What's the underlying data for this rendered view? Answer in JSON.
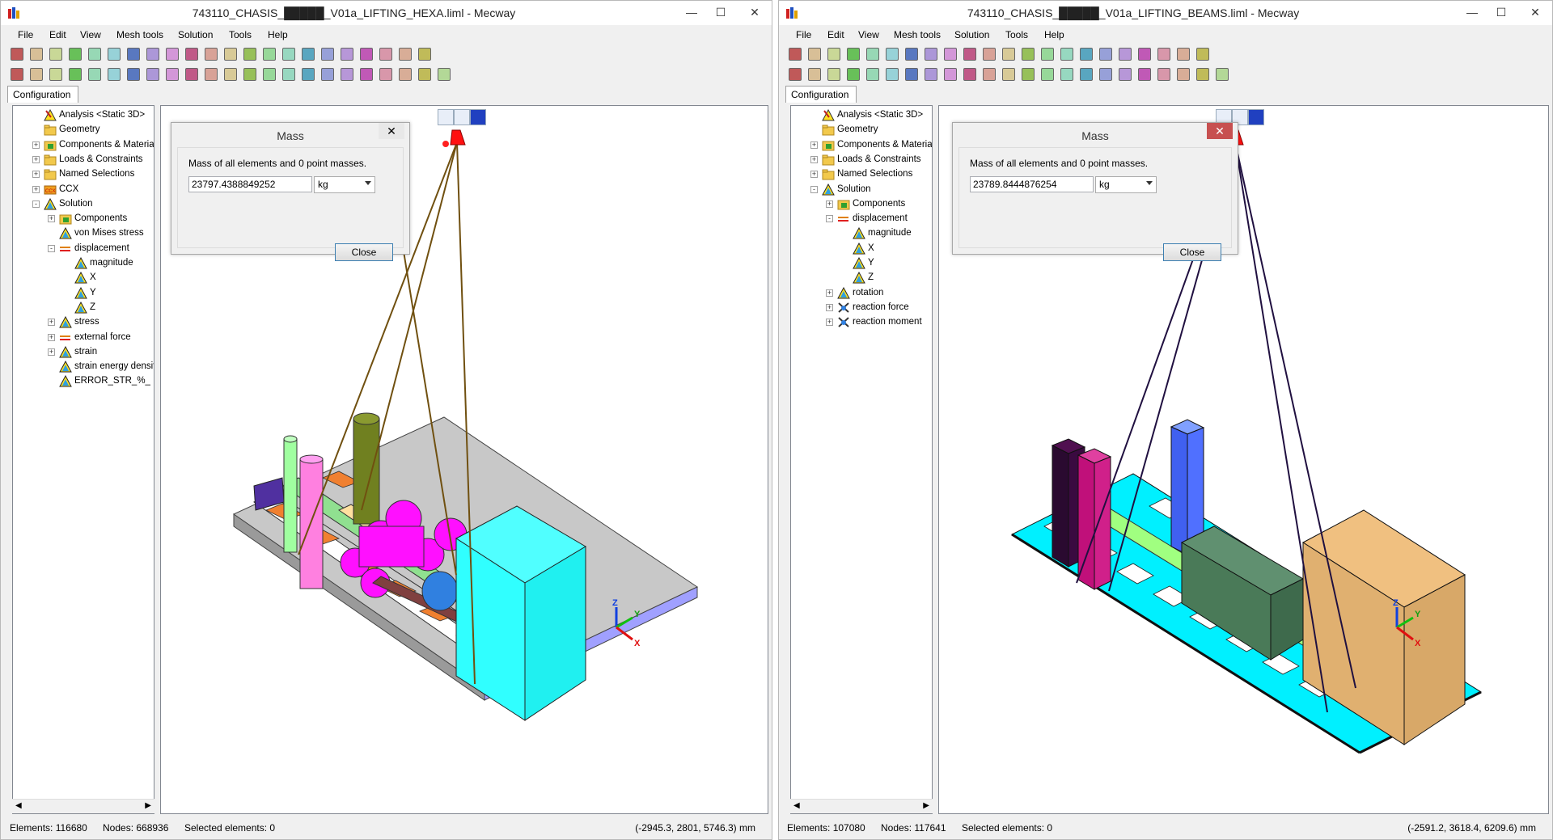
{
  "colors": {
    "accent": "#3c7fb1",
    "close_red": "#c75050"
  },
  "menu": [
    "File",
    "Edit",
    "View",
    "Mesh tools",
    "Solution",
    "Tools",
    "Help"
  ],
  "left": {
    "title": "743110_CHASIS_█████_V01a_LIFTING_HEXA.liml - Mecway",
    "tab": "Configuration",
    "tree": [
      {
        "label": "Analysis <Static 3D>",
        "icon": "analysis-icon",
        "indent": 0,
        "exp": ""
      },
      {
        "label": "Geometry",
        "icon": "folder-icon",
        "indent": 0,
        "exp": ""
      },
      {
        "label": "Components & Materials",
        "icon": "components-icon",
        "indent": 0,
        "exp": "+"
      },
      {
        "label": "Loads & Constraints",
        "icon": "folder-icon",
        "indent": 0,
        "exp": "+"
      },
      {
        "label": "Named Selections",
        "icon": "folder-icon",
        "indent": 0,
        "exp": "+"
      },
      {
        "label": "CCX",
        "icon": "ccx-icon",
        "indent": 0,
        "exp": "+"
      },
      {
        "label": "Solution",
        "icon": "solution-icon",
        "indent": 0,
        "exp": "-"
      },
      {
        "label": "Components",
        "icon": "components-icon",
        "indent": 1,
        "exp": "+"
      },
      {
        "label": "von Mises stress",
        "icon": "solution-icon",
        "indent": 1,
        "exp": ""
      },
      {
        "label": "displacement",
        "icon": "displacement-icon",
        "indent": 1,
        "exp": "-"
      },
      {
        "label": "magnitude",
        "icon": "solution-icon",
        "indent": 2,
        "exp": ""
      },
      {
        "label": "X",
        "icon": "solution-icon",
        "indent": 2,
        "exp": ""
      },
      {
        "label": "Y",
        "icon": "solution-icon",
        "indent": 2,
        "exp": ""
      },
      {
        "label": "Z",
        "icon": "solution-icon",
        "indent": 2,
        "exp": ""
      },
      {
        "label": "stress",
        "icon": "solution-icon",
        "indent": 1,
        "exp": "+"
      },
      {
        "label": "external force",
        "icon": "displacement-icon",
        "indent": 1,
        "exp": "+"
      },
      {
        "label": "strain",
        "icon": "solution-icon",
        "indent": 1,
        "exp": "+"
      },
      {
        "label": "strain energy density",
        "icon": "solution-icon",
        "indent": 1,
        "exp": ""
      },
      {
        "label": "ERROR_STR_%_",
        "icon": "solution-icon",
        "indent": 1,
        "exp": ""
      }
    ],
    "dialog": {
      "title": "Mass",
      "message": "Mass of all elements and 0 point masses.",
      "value": "23797.4388849252",
      "unit": "kg",
      "button": "Close"
    },
    "status": {
      "elements": "Elements: 116680",
      "nodes": "Nodes: 668936",
      "selected": "Selected elements: 0",
      "coords": "(-2945.3, 2801, 5746.3) mm"
    }
  },
  "right": {
    "title": "743110_CHASIS_█████_V01a_LIFTING_BEAMS.liml - Mecway",
    "tab": "Configuration",
    "tree": [
      {
        "label": "Analysis <Static 3D>",
        "icon": "analysis-icon",
        "indent": 0,
        "exp": ""
      },
      {
        "label": "Geometry",
        "icon": "folder-icon",
        "indent": 0,
        "exp": ""
      },
      {
        "label": "Components & Materials",
        "icon": "components-icon",
        "indent": 0,
        "exp": "+"
      },
      {
        "label": "Loads & Constraints",
        "icon": "folder-icon",
        "indent": 0,
        "exp": "+"
      },
      {
        "label": "Named Selections",
        "icon": "folder-icon",
        "indent": 0,
        "exp": "+"
      },
      {
        "label": "Solution",
        "icon": "solution-icon",
        "indent": 0,
        "exp": "-"
      },
      {
        "label": "Components",
        "icon": "components-icon",
        "indent": 1,
        "exp": "+"
      },
      {
        "label": "displacement",
        "icon": "displacement-icon",
        "indent": 1,
        "exp": "-"
      },
      {
        "label": "magnitude",
        "icon": "solution-icon",
        "indent": 2,
        "exp": ""
      },
      {
        "label": "X",
        "icon": "solution-icon",
        "indent": 2,
        "exp": ""
      },
      {
        "label": "Y",
        "icon": "solution-icon",
        "indent": 2,
        "exp": ""
      },
      {
        "label": "Z",
        "icon": "solution-icon",
        "indent": 2,
        "exp": ""
      },
      {
        "label": "rotation",
        "icon": "solution-icon",
        "indent": 1,
        "exp": "+"
      },
      {
        "label": "reaction force",
        "icon": "reaction-icon",
        "indent": 1,
        "exp": "+"
      },
      {
        "label": "reaction moment",
        "icon": "reaction-icon",
        "indent": 1,
        "exp": "+"
      }
    ],
    "dialog": {
      "title": "Mass",
      "message": "Mass of all elements and 0 point masses.",
      "value": "23789.8444876254",
      "unit": "kg",
      "button": "Close"
    },
    "status": {
      "elements": "Elements: 107080",
      "nodes": "Nodes: 117641",
      "selected": "Selected elements: 0",
      "coords": "(-2591.2, 3618.4, 6209.6) mm"
    }
  },
  "axes": {
    "x": "X",
    "y": "Y",
    "z": "Z"
  }
}
